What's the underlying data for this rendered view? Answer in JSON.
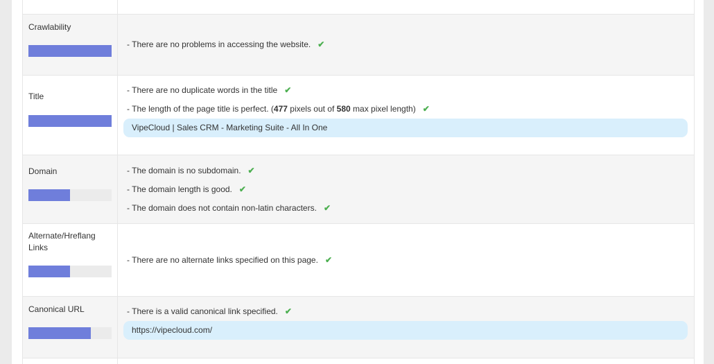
{
  "rows": [
    {
      "label": "Crawlability",
      "score": 1.0,
      "messages": [
        {
          "text": "- There are no problems in accessing the website.",
          "icon": "checkmark-icon"
        }
      ]
    },
    {
      "label": "Title",
      "score": 1.0,
      "messages": [
        {
          "text": "- There are no duplicate words in the title",
          "icon": "checkmark-icon"
        },
        {
          "pre": "- The length of the page title is perfect. (",
          "b1": "477",
          "mid": " pixels out of ",
          "b2": "580",
          "post": " max pixel length)",
          "icon": "checkmark-icon"
        }
      ],
      "value": "VipeCloud | Sales CRM - Marketing Suite - All In One"
    },
    {
      "label": "Domain",
      "score": 0.5,
      "messages": [
        {
          "text": "- The domain is no subdomain.",
          "icon": "checkmark-icon"
        },
        {
          "text": "- The domain length is good.",
          "icon": "checkmark-icon"
        },
        {
          "text": "- The domain does not contain non-latin characters.",
          "icon": "checkmark-icon"
        }
      ]
    },
    {
      "label": "Alternate/Hreflang Links",
      "score": 0.5,
      "messages": [
        {
          "text": "- There are no alternate links specified on this page.",
          "icon": "checkmark-icon"
        }
      ]
    },
    {
      "label": "Canonical URL",
      "score": 0.75,
      "messages": [
        {
          "text": "- There is a valid canonical link specified.",
          "icon": "checkmark-icon"
        }
      ],
      "value": "https://vipecloud.com/"
    }
  ],
  "colors": {
    "bar_fill": "#6f7edb",
    "bar_track": "#ebebeb",
    "check": "#4caf50",
    "pill": "#d9effc"
  }
}
